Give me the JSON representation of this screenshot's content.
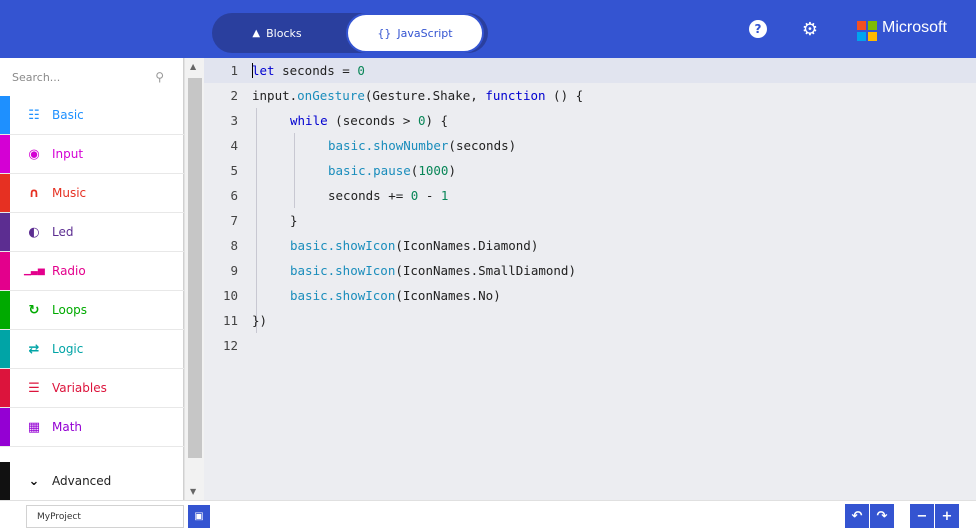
{
  "header": {
    "tabs": [
      {
        "label": "Blocks",
        "icon": "blocks-icon"
      },
      {
        "label": "JavaScript",
        "icon": "braces-icon"
      }
    ],
    "active_tab": "JavaScript",
    "help_icon": "?",
    "brand": "Microsoft",
    "colors": {
      "header": "#3454d1",
      "toggle": "#2a3f9e"
    }
  },
  "toolbox": {
    "search_placeholder": "Search...",
    "categories": [
      {
        "label": "Basic",
        "icon": "grid-icon",
        "color": "#1e90ff"
      },
      {
        "label": "Input",
        "icon": "target-icon",
        "color": "#d400d4"
      },
      {
        "label": "Music",
        "icon": "headphones-icon",
        "color": "#e63022"
      },
      {
        "label": "Led",
        "icon": "toggle-icon",
        "color": "#5c2d91"
      },
      {
        "label": "Radio",
        "icon": "signal-icon",
        "color": "#e3008c"
      },
      {
        "label": "Loops",
        "icon": "loop-icon",
        "color": "#00aa00"
      },
      {
        "label": "Logic",
        "icon": "shuffle-icon",
        "color": "#00a4a6"
      },
      {
        "label": "Variables",
        "icon": "list-icon",
        "color": "#dc143c"
      },
      {
        "label": "Math",
        "icon": "calculator-icon",
        "color": "#9400d3"
      }
    ],
    "advanced": {
      "label": "Advanced",
      "icon": "chevron-down-icon",
      "color": "#111111"
    }
  },
  "editor": {
    "lines": [
      {
        "n": "1"
      },
      {
        "n": "2"
      },
      {
        "n": "3"
      },
      {
        "n": "4"
      },
      {
        "n": "5"
      },
      {
        "n": "6"
      },
      {
        "n": "7"
      },
      {
        "n": "8"
      },
      {
        "n": "9"
      },
      {
        "n": "10"
      },
      {
        "n": "11"
      },
      {
        "n": "12"
      }
    ],
    "code": {
      "l1": {
        "kw": "let",
        "rest": " seconds = ",
        "num": "0"
      },
      "l2": {
        "fn1": "input.",
        "fn2": "onGesture",
        "mid": "(Gesture.Shake, ",
        "kw": "function",
        "rest": " () {"
      },
      "l3": {
        "kw": "while",
        "rest": " (seconds > ",
        "num": "0",
        "end": ") {"
      },
      "l4": {
        "fn": "basic.showNumber",
        "rest": "(seconds)"
      },
      "l5": {
        "fn": "basic.pause",
        "open": "(",
        "num": "1000",
        "close": ")"
      },
      "l6": {
        "rest": "seconds += ",
        "num1": "0",
        "mid": " - ",
        "num2": "1"
      },
      "l7": {
        "rest": "}"
      },
      "l8": {
        "fn": "basic.showIcon",
        "rest": "(IconNames.Diamond)"
      },
      "l9": {
        "fn": "basic.showIcon",
        "rest": "(IconNames.SmallDiamond)"
      },
      "l10": {
        "fn": "basic.showIcon",
        "rest": "(IconNames.No)"
      },
      "l11": {
        "rest": "})"
      }
    }
  },
  "footer": {
    "project_name": "MyProject",
    "save_icon": "save-icon",
    "undo_icon": "undo-icon",
    "redo_icon": "redo-icon",
    "zoom_out_icon": "zoom-out-icon",
    "zoom_in_icon": "zoom-in-icon"
  }
}
